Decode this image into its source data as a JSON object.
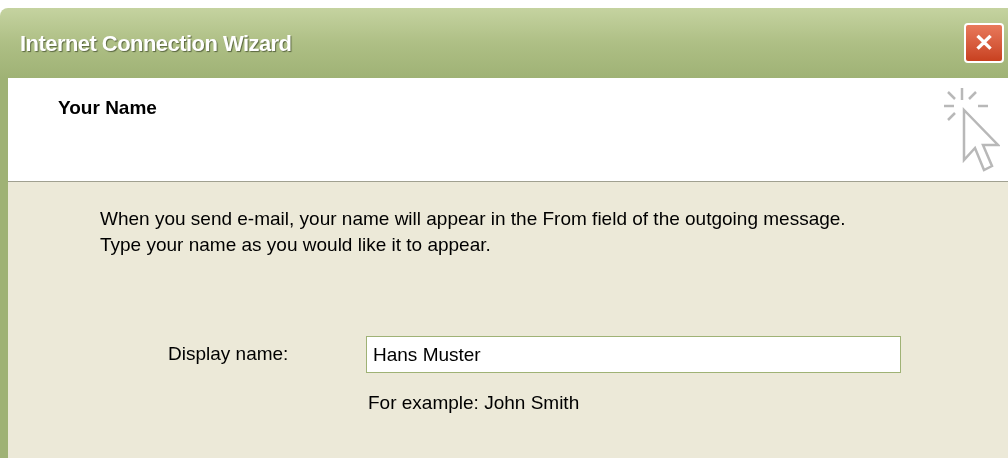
{
  "window": {
    "title": "Internet Connection Wizard",
    "close": "✕"
  },
  "header": {
    "title": "Your Name"
  },
  "intro": [
    "When you send e-mail, your name will appear in the From field of the outgoing message.",
    "Type your name as you would like it to appear."
  ],
  "field": {
    "label": "Display name:",
    "value": "Hans Muster",
    "example": "For example: John Smith"
  }
}
